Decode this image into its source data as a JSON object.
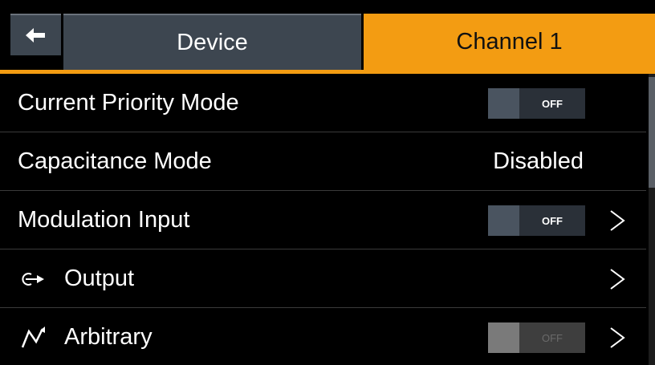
{
  "header": {
    "back_icon": "arrow-left-icon",
    "tabs": [
      {
        "label": "Device",
        "active": false
      },
      {
        "label": "Channel 1",
        "active": true
      }
    ],
    "accent_color": "#f39c12"
  },
  "rows": [
    {
      "label": "Current Priority Mode",
      "control": "toggle",
      "toggle_text": "OFF",
      "enabled": true,
      "chevron": false
    },
    {
      "label": "Capacitance Mode",
      "control": "value",
      "value": "Disabled",
      "chevron": false
    },
    {
      "label": "Modulation Input",
      "control": "toggle",
      "toggle_text": "OFF",
      "enabled": true,
      "chevron": true
    },
    {
      "label": "Output",
      "icon": "output-icon",
      "control": "none",
      "chevron": true
    },
    {
      "label": "Arbitrary",
      "icon": "arbitrary-icon",
      "control": "toggle",
      "toggle_text": "OFF",
      "enabled": false,
      "chevron": true
    }
  ]
}
